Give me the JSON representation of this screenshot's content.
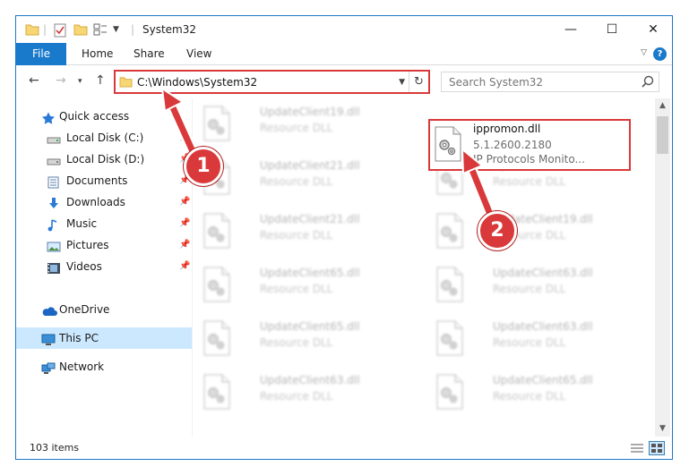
{
  "window": {
    "title": "System32",
    "controls": {
      "minimize": "—",
      "maximize": "☐",
      "close": "✕"
    }
  },
  "ribbon": {
    "file": "File",
    "tabs": [
      "Home",
      "Share",
      "View"
    ],
    "help": "?"
  },
  "nav": {
    "address": "C:\\Windows\\System32",
    "search_placeholder": "Search System32"
  },
  "sidebar": {
    "items": [
      {
        "label": "Quick access",
        "icon": "star-icon",
        "pinned": false
      },
      {
        "label": "Local Disk (C:)",
        "icon": "drive-icon",
        "pinned": true
      },
      {
        "label": "Local Disk (D:)",
        "icon": "drive-icon",
        "pinned": true
      },
      {
        "label": "Documents",
        "icon": "documents-icon",
        "pinned": true
      },
      {
        "label": "Downloads",
        "icon": "downloads-icon",
        "pinned": true
      },
      {
        "label": "Music",
        "icon": "music-icon",
        "pinned": true
      },
      {
        "label": "Pictures",
        "icon": "pictures-icon",
        "pinned": true
      },
      {
        "label": "Videos",
        "icon": "videos-icon",
        "pinned": true
      },
      {
        "label": "OneDrive",
        "icon": "onedrive-icon",
        "pinned": false
      },
      {
        "label": "This PC",
        "icon": "pc-icon",
        "pinned": false,
        "selected": true
      },
      {
        "label": "Network",
        "icon": "network-icon",
        "pinned": false
      }
    ]
  },
  "files": {
    "highlighted": {
      "name": "ippromon.dll",
      "version": "5.1.2600.2180",
      "description": "IP Protocols Monito..."
    },
    "left_column": [
      {
        "name": "UpdateClient19.dll",
        "desc": "Resource DLL"
      },
      {
        "name": "UpdateClient21.dll",
        "desc": "Resource DLL"
      },
      {
        "name": "UpdateClient21.dll",
        "desc": "Resource DLL"
      },
      {
        "name": "UpdateClient65.dll",
        "desc": "Resource DLL"
      },
      {
        "name": "UpdateClient65.dll",
        "desc": "Resource DLL"
      },
      {
        "name": "UpdateClient63.dll",
        "desc": "Resource DLL"
      }
    ],
    "right_column": [
      {
        "name": "UpdateClient21.dll",
        "desc": "Resource DLL"
      },
      {
        "name": "UpdateClient19.dll",
        "desc": "Resource DLL"
      },
      {
        "name": "UpdateClient63.dll",
        "desc": "Resource DLL"
      },
      {
        "name": "UpdateClient63.dll",
        "desc": "Resource DLL"
      },
      {
        "name": "UpdateClient65.dll",
        "desc": "Resource DLL"
      }
    ]
  },
  "status": {
    "count": "103 items"
  },
  "annotations": [
    {
      "number": "1",
      "color": "#d9393a"
    },
    {
      "number": "2",
      "color": "#d9393a"
    }
  ],
  "colors": {
    "accent": "#1979ca",
    "selection": "#cce8ff",
    "annotation": "#d9393a"
  }
}
